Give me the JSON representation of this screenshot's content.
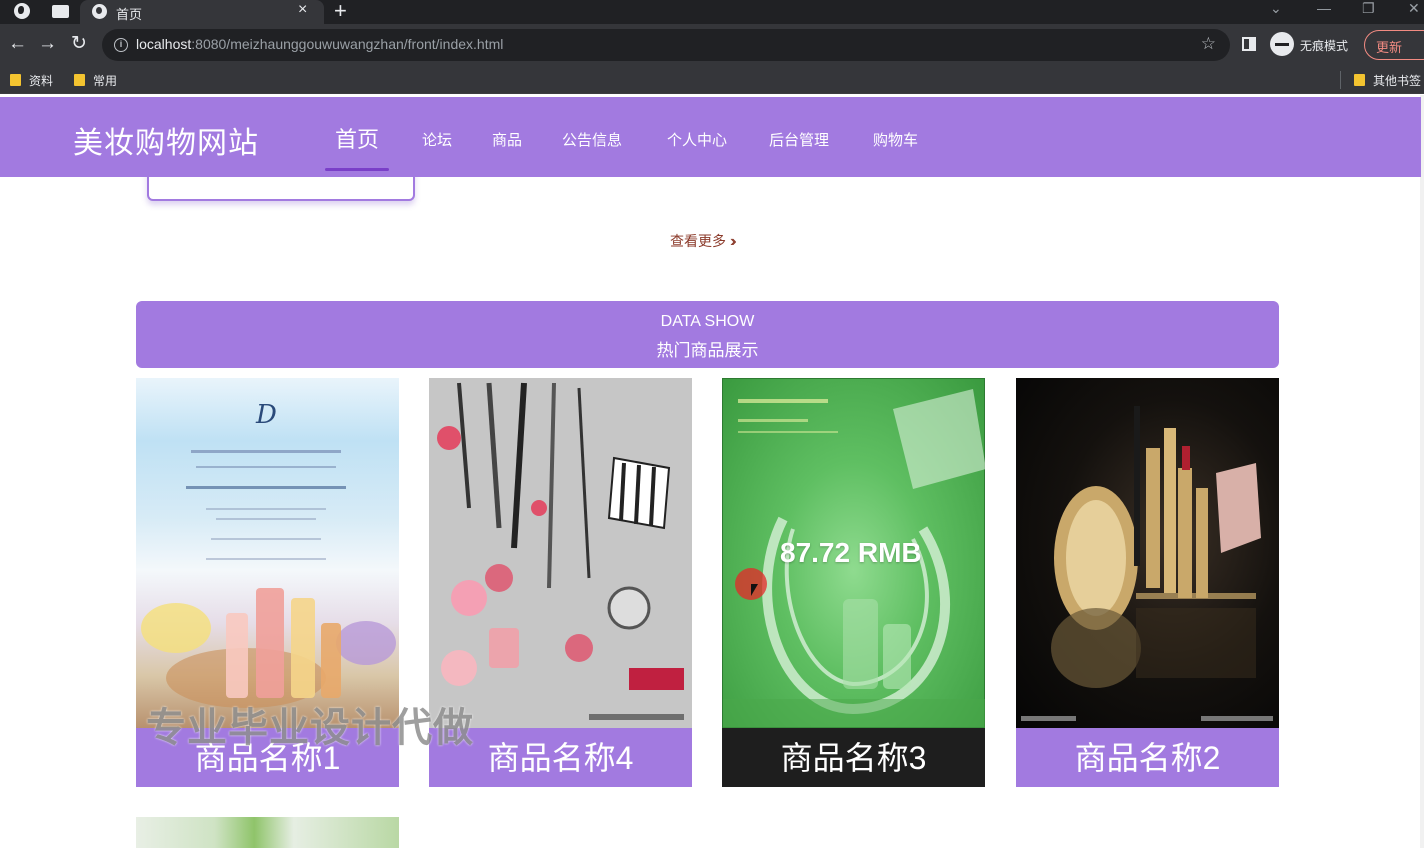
{
  "browser": {
    "tab_title": "首页",
    "tab_close": "×",
    "new_tab": "+",
    "url_host": "localhost",
    "url_rest": ":8080/meizhaunggouwuwangzhan/front/index.html",
    "incognito_label": "无痕模式",
    "update_label": "更新",
    "bookmarks": [
      "资料",
      "常用"
    ],
    "other_bookmarks": "其他书签"
  },
  "site": {
    "title": "美妆购物网站",
    "nav": [
      {
        "label": "首页",
        "active": true
      },
      {
        "label": "论坛"
      },
      {
        "label": "商品"
      },
      {
        "label": "公告信息"
      },
      {
        "label": "个人中心"
      },
      {
        "label": "后台管理"
      },
      {
        "label": "购物车"
      }
    ]
  },
  "more_link": "查看更多",
  "section": {
    "title_en": "DATA SHOW",
    "title_cn": "热门商品展示"
  },
  "products": [
    {
      "name": "商品名称1",
      "bg": "#a27ae0"
    },
    {
      "name": "商品名称4",
      "bg": "#a27ae0"
    },
    {
      "name": "商品名称3",
      "bg": "#1e1e1e",
      "price_overlay": "87.72 RMB"
    },
    {
      "name": "商品名称2",
      "bg": "#a27ae0"
    }
  ],
  "watermark": "专业毕业设计代做",
  "colors": {
    "header": "#a27ae0",
    "accent": "#7a3fc8",
    "more_link": "#8b3a2a"
  }
}
